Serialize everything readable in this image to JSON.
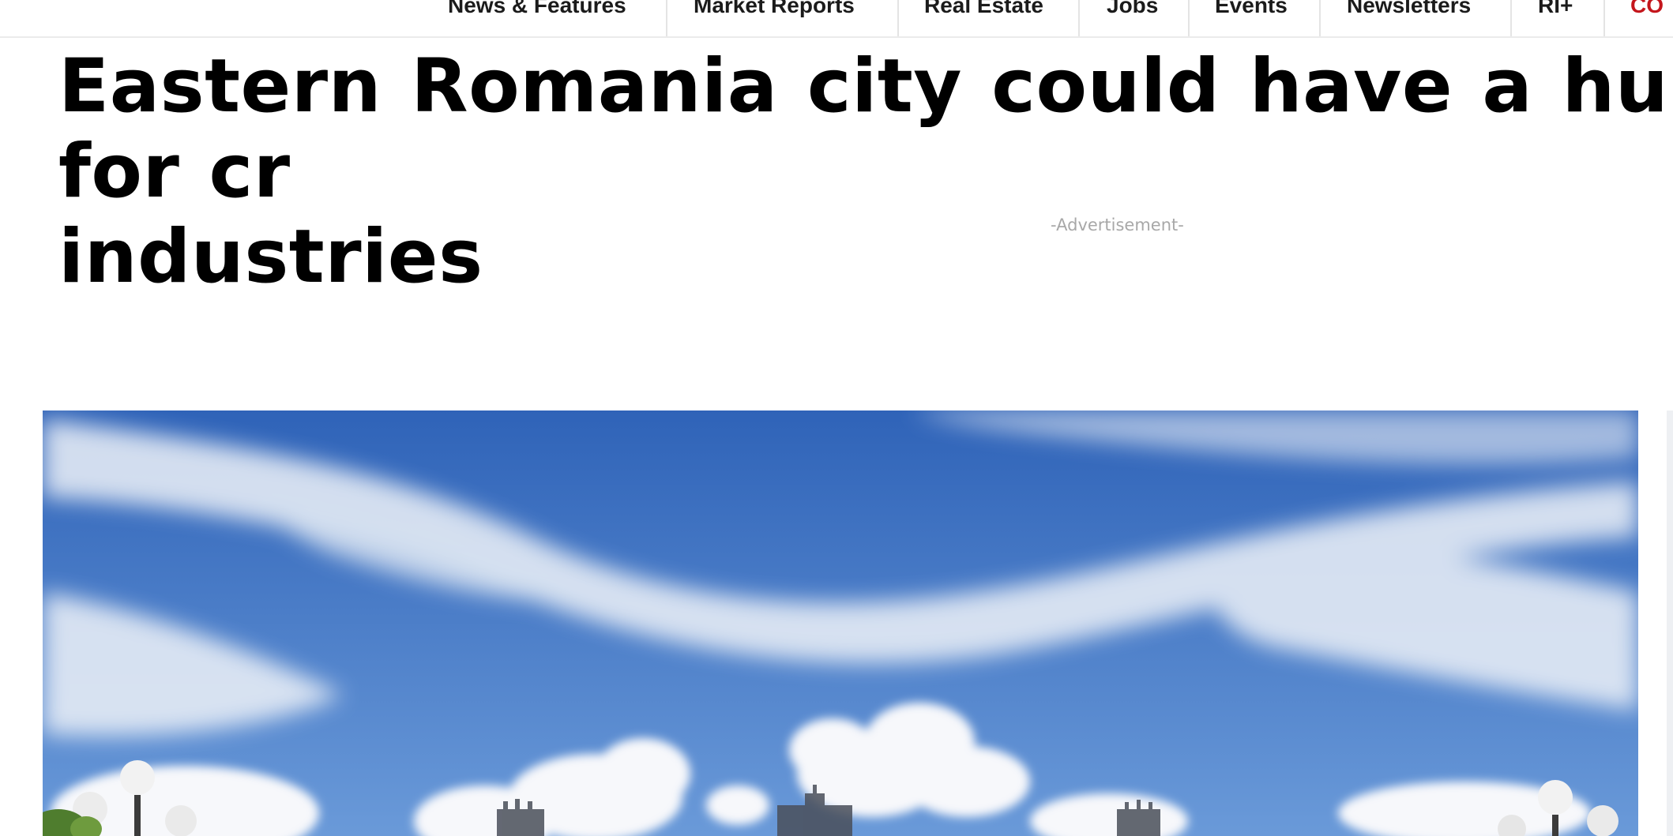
{
  "nav": {
    "items": [
      {
        "label": "News & Features"
      },
      {
        "label": "Market Reports"
      },
      {
        "label": "Real Estate"
      },
      {
        "label": "Jobs"
      },
      {
        "label": "Events"
      },
      {
        "label": "Newsletters"
      },
      {
        "label": "RI+"
      },
      {
        "label": "CO"
      }
    ]
  },
  "article": {
    "headline_line1": "Eastern Romania city could have a hub for cr",
    "headline_line2": "industries"
  },
  "ad": {
    "label": "-Advertisement-"
  },
  "hero": {
    "icon": "hero-photo",
    "colors": {
      "sky_top": "#2f63b8",
      "sky_bottom": "#5b8fd6",
      "cloud": "#f4f6f9"
    }
  }
}
